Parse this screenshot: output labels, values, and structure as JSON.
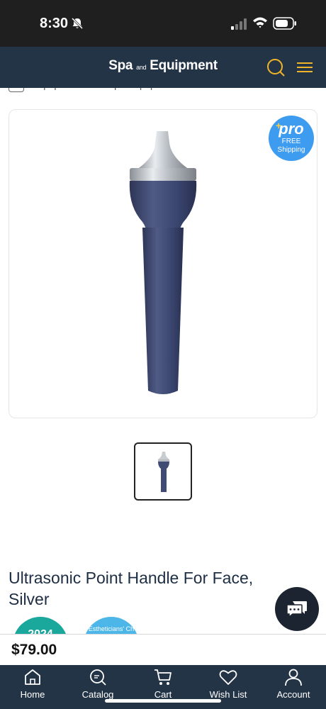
{
  "status_bar": {
    "time": "8:30"
  },
  "header": {
    "brand_main_1": "Spa",
    "brand_and": "and",
    "brand_main_2": "Equipment"
  },
  "breadcrumb": {
    "items": [
      "Equipment",
      ">",
      "Spa Equipment",
      ">",
      "Parts & Accessories"
    ]
  },
  "badge": {
    "pro": "pro",
    "line1": "FREE",
    "line2": "Shipping"
  },
  "product": {
    "title": "Ultrasonic Point Handle For Face, Silver",
    "price": "$79.00"
  },
  "awards": {
    "year": "2024",
    "cert": "Estheticians' Ch"
  },
  "bottom_nav": {
    "items": [
      {
        "label": "Home",
        "icon": "home-icon"
      },
      {
        "label": "Catalog",
        "icon": "catalog-icon"
      },
      {
        "label": "Cart",
        "icon": "cart-icon"
      },
      {
        "label": "Wish List",
        "icon": "heart-icon"
      },
      {
        "label": "Account",
        "icon": "user-icon"
      }
    ]
  },
  "colors": {
    "header_bg": "#243447",
    "title_text": "#1d2e44",
    "pro_badge": "#3d9bf0",
    "handle_body": "#3f4b72"
  }
}
